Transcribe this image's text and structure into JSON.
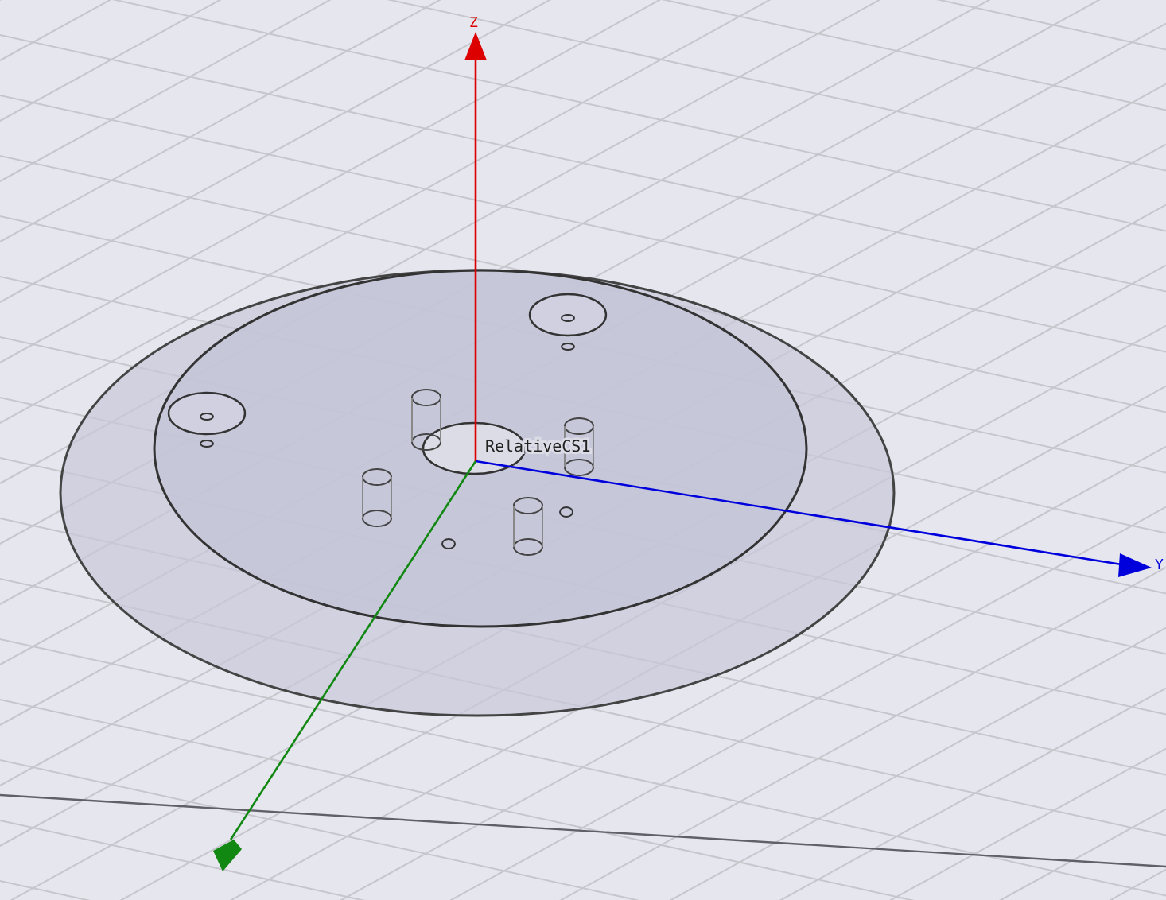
{
  "viewport": {
    "axes": [
      {
        "kind": "z",
        "label": "Z"
      },
      {
        "kind": "y",
        "label": "Y"
      },
      {
        "kind": "x"
      }
    ],
    "coordinate_system": {
      "label": "RelativeCS1"
    }
  }
}
